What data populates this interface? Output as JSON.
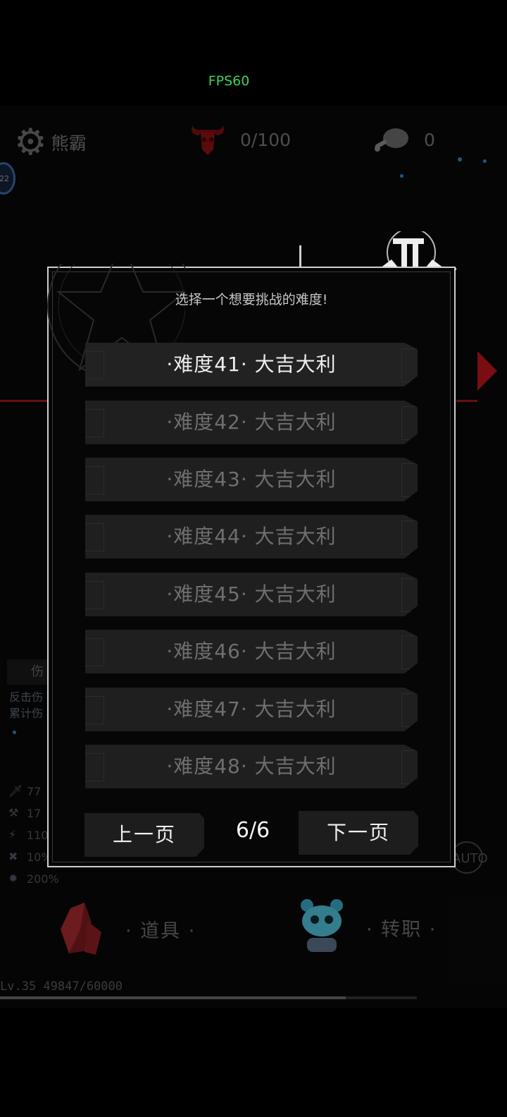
{
  "fps": "FPS60",
  "hud": {
    "name": "熊霸",
    "progress": "0/100",
    "meat_count": "0",
    "level_badge": "22"
  },
  "background": {
    "side_label": "伤",
    "side_line1": "反击伤",
    "side_line2": "累计伤",
    "stats": [
      "77",
      "17",
      "110",
      "10%",
      "200%"
    ],
    "auto": "AUTO"
  },
  "menu": {
    "items": "· 道具 ·",
    "job_change": "· 转职 ·"
  },
  "xp": {
    "text": "Lv.35   49847/60000",
    "fraction": 0.83
  },
  "dialog": {
    "title": "选择一个想要挑战的难度!",
    "levels": [
      "·难度41·  大吉大利",
      "·难度42·  大吉大利",
      "·难度43·  大吉大利",
      "·难度44·  大吉大利",
      "·难度45·  大吉大利",
      "·难度46·  大吉大利",
      "·难度47·  大吉大利",
      "·难度48·  大吉大利"
    ],
    "prev_page": "上一页",
    "next_page": "下一页",
    "page": "6/6"
  },
  "colors": {
    "fps": "#3fd35a",
    "accent_red": "#b8151c",
    "accent_blue": "#1e90c8"
  }
}
